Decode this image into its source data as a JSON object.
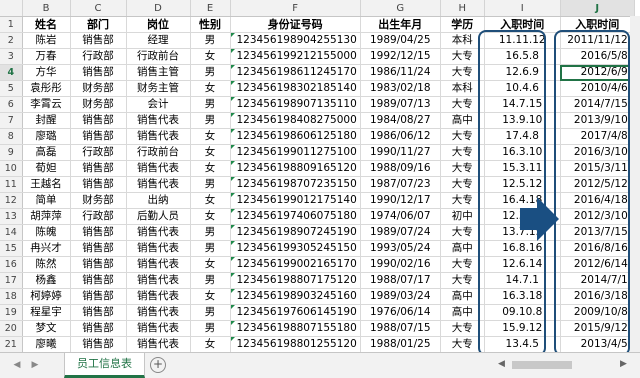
{
  "columns": [
    "B",
    "C",
    "D",
    "E",
    "F",
    "G",
    "H",
    "I",
    "J"
  ],
  "selected_column": "J",
  "selected_row": 4,
  "header_row": 1,
  "headers": {
    "name": "姓名",
    "department": "部门",
    "position": "岗位",
    "gender": "性别",
    "id_number": "身份证号码",
    "birth_month": "出生年月",
    "education": "学历",
    "hire_date_raw": "入职时间",
    "hire_date": "入职时间"
  },
  "rows": [
    {
      "row": 2,
      "name": "陈岩",
      "department": "销售部",
      "position": "经理",
      "gender": "男",
      "id_number": "123456198904255130",
      "birth_month": "1989/04/25",
      "education": "本科",
      "hire_date_raw": "11.11.12",
      "hire_date": "2011/11/12"
    },
    {
      "row": 3,
      "name": "万春",
      "department": "行政部",
      "position": "行政前台",
      "gender": "女",
      "id_number": "123456199212155000",
      "birth_month": "1992/12/15",
      "education": "大专",
      "hire_date_raw": "16.5.8",
      "hire_date": "2016/5/8"
    },
    {
      "row": 4,
      "name": "方华",
      "department": "销售部",
      "position": "销售主管",
      "gender": "男",
      "id_number": "123456198611245170",
      "birth_month": "1986/11/24",
      "education": "大专",
      "hire_date_raw": "12.6.9",
      "hire_date": "2012/6/9"
    },
    {
      "row": 5,
      "name": "袁彤彤",
      "department": "财务部",
      "position": "财务主管",
      "gender": "女",
      "id_number": "123456198302185140",
      "birth_month": "1983/02/18",
      "education": "本科",
      "hire_date_raw": "10.4.6",
      "hire_date": "2010/4/6"
    },
    {
      "row": 6,
      "name": "李霄云",
      "department": "财务部",
      "position": "会计",
      "gender": "男",
      "id_number": "123456198907135110",
      "birth_month": "1989/07/13",
      "education": "大专",
      "hire_date_raw": "14.7.15",
      "hire_date": "2014/7/15"
    },
    {
      "row": 7,
      "name": "封醒",
      "department": "销售部",
      "position": "销售代表",
      "gender": "男",
      "id_number": "123456198408275000",
      "birth_month": "1984/08/27",
      "education": "高中",
      "hire_date_raw": "13.9.10",
      "hire_date": "2013/9/10"
    },
    {
      "row": 8,
      "name": "廖璐",
      "department": "销售部",
      "position": "销售代表",
      "gender": "女",
      "id_number": "123456198606125180",
      "birth_month": "1986/06/12",
      "education": "大专",
      "hire_date_raw": "17.4.8",
      "hire_date": "2017/4/8"
    },
    {
      "row": 9,
      "name": "高磊",
      "department": "行政部",
      "position": "行政前台",
      "gender": "女",
      "id_number": "123456199011275100",
      "birth_month": "1990/11/27",
      "education": "大专",
      "hire_date_raw": "16.3.10",
      "hire_date": "2016/3/10"
    },
    {
      "row": 10,
      "name": "荀妲",
      "department": "销售部",
      "position": "销售代表",
      "gender": "女",
      "id_number": "123456198809165120",
      "birth_month": "1988/09/16",
      "education": "大专",
      "hire_date_raw": "15.3.11",
      "hire_date": "2015/3/11"
    },
    {
      "row": 11,
      "name": "王越名",
      "department": "销售部",
      "position": "销售代表",
      "gender": "男",
      "id_number": "123456198707235150",
      "birth_month": "1987/07/23",
      "education": "大专",
      "hire_date_raw": "12.5.12",
      "hire_date": "2012/5/12"
    },
    {
      "row": 12,
      "name": "简单",
      "department": "财务部",
      "position": "出纳",
      "gender": "女",
      "id_number": "123456199012175140",
      "birth_month": "1990/12/17",
      "education": "大专",
      "hire_date_raw": "16.4.18",
      "hire_date": "2016/4/18"
    },
    {
      "row": 13,
      "name": "胡萍萍",
      "department": "行政部",
      "position": "后勤人员",
      "gender": "女",
      "id_number": "123456197406075180",
      "birth_month": "1974/06/07",
      "education": "初中",
      "hire_date_raw": "12.3.10",
      "hire_date": "2012/3/10"
    },
    {
      "row": 14,
      "name": "陈魄",
      "department": "销售部",
      "position": "销售代表",
      "gender": "男",
      "id_number": "123456198907245190",
      "birth_month": "1989/07/24",
      "education": "大专",
      "hire_date_raw": "13.7.15",
      "hire_date": "2013/7/15"
    },
    {
      "row": 15,
      "name": "冉兴才",
      "department": "销售部",
      "position": "销售代表",
      "gender": "男",
      "id_number": "123456199305245150",
      "birth_month": "1993/05/24",
      "education": "高中",
      "hire_date_raw": "16.8.16",
      "hire_date": "2016/8/16"
    },
    {
      "row": 16,
      "name": "陈然",
      "department": "销售部",
      "position": "销售代表",
      "gender": "女",
      "id_number": "123456199002165170",
      "birth_month": "1990/02/16",
      "education": "大专",
      "hire_date_raw": "12.6.14",
      "hire_date": "2012/6/14"
    },
    {
      "row": 17,
      "name": "杨鑫",
      "department": "销售部",
      "position": "销售代表",
      "gender": "男",
      "id_number": "123456198807175120",
      "birth_month": "1988/07/17",
      "education": "大专",
      "hire_date_raw": "14.7.1",
      "hire_date": "2014/7/1"
    },
    {
      "row": 18,
      "name": "柯婷婷",
      "department": "销售部",
      "position": "销售代表",
      "gender": "女",
      "id_number": "123456198903245160",
      "birth_month": "1989/03/24",
      "education": "高中",
      "hire_date_raw": "16.3.18",
      "hire_date": "2016/3/18"
    },
    {
      "row": 19,
      "name": "程星宇",
      "department": "销售部",
      "position": "销售代表",
      "gender": "男",
      "id_number": "123456197606145190",
      "birth_month": "1976/06/14",
      "education": "高中",
      "hire_date_raw": "09.10.8",
      "hire_date": "2009/10/8"
    },
    {
      "row": 20,
      "name": "梦文",
      "department": "销售部",
      "position": "销售代表",
      "gender": "男",
      "id_number": "123456198807155180",
      "birth_month": "1988/07/15",
      "education": "大专",
      "hire_date_raw": "15.9.12",
      "hire_date": "2015/9/12"
    },
    {
      "row": 21,
      "name": "廖曦",
      "department": "销售部",
      "position": "销售代表",
      "gender": "女",
      "id_number": "123456198801255120",
      "birth_month": "1988/01/25",
      "education": "大专",
      "hire_date_raw": "13.4.5",
      "hire_date": "2013/4/5"
    }
  ],
  "sheet_tab": "员工信息表",
  "add_sheet_symbol": "⊕",
  "accent_color": "#217346",
  "highlight_box_color": "#1f4e79",
  "arrow_color": "#1a4f82",
  "icons": [
    "arrow-right-icon",
    "sheet-nav-left-icon",
    "sheet-nav-right-icon",
    "add-sheet-icon"
  ]
}
